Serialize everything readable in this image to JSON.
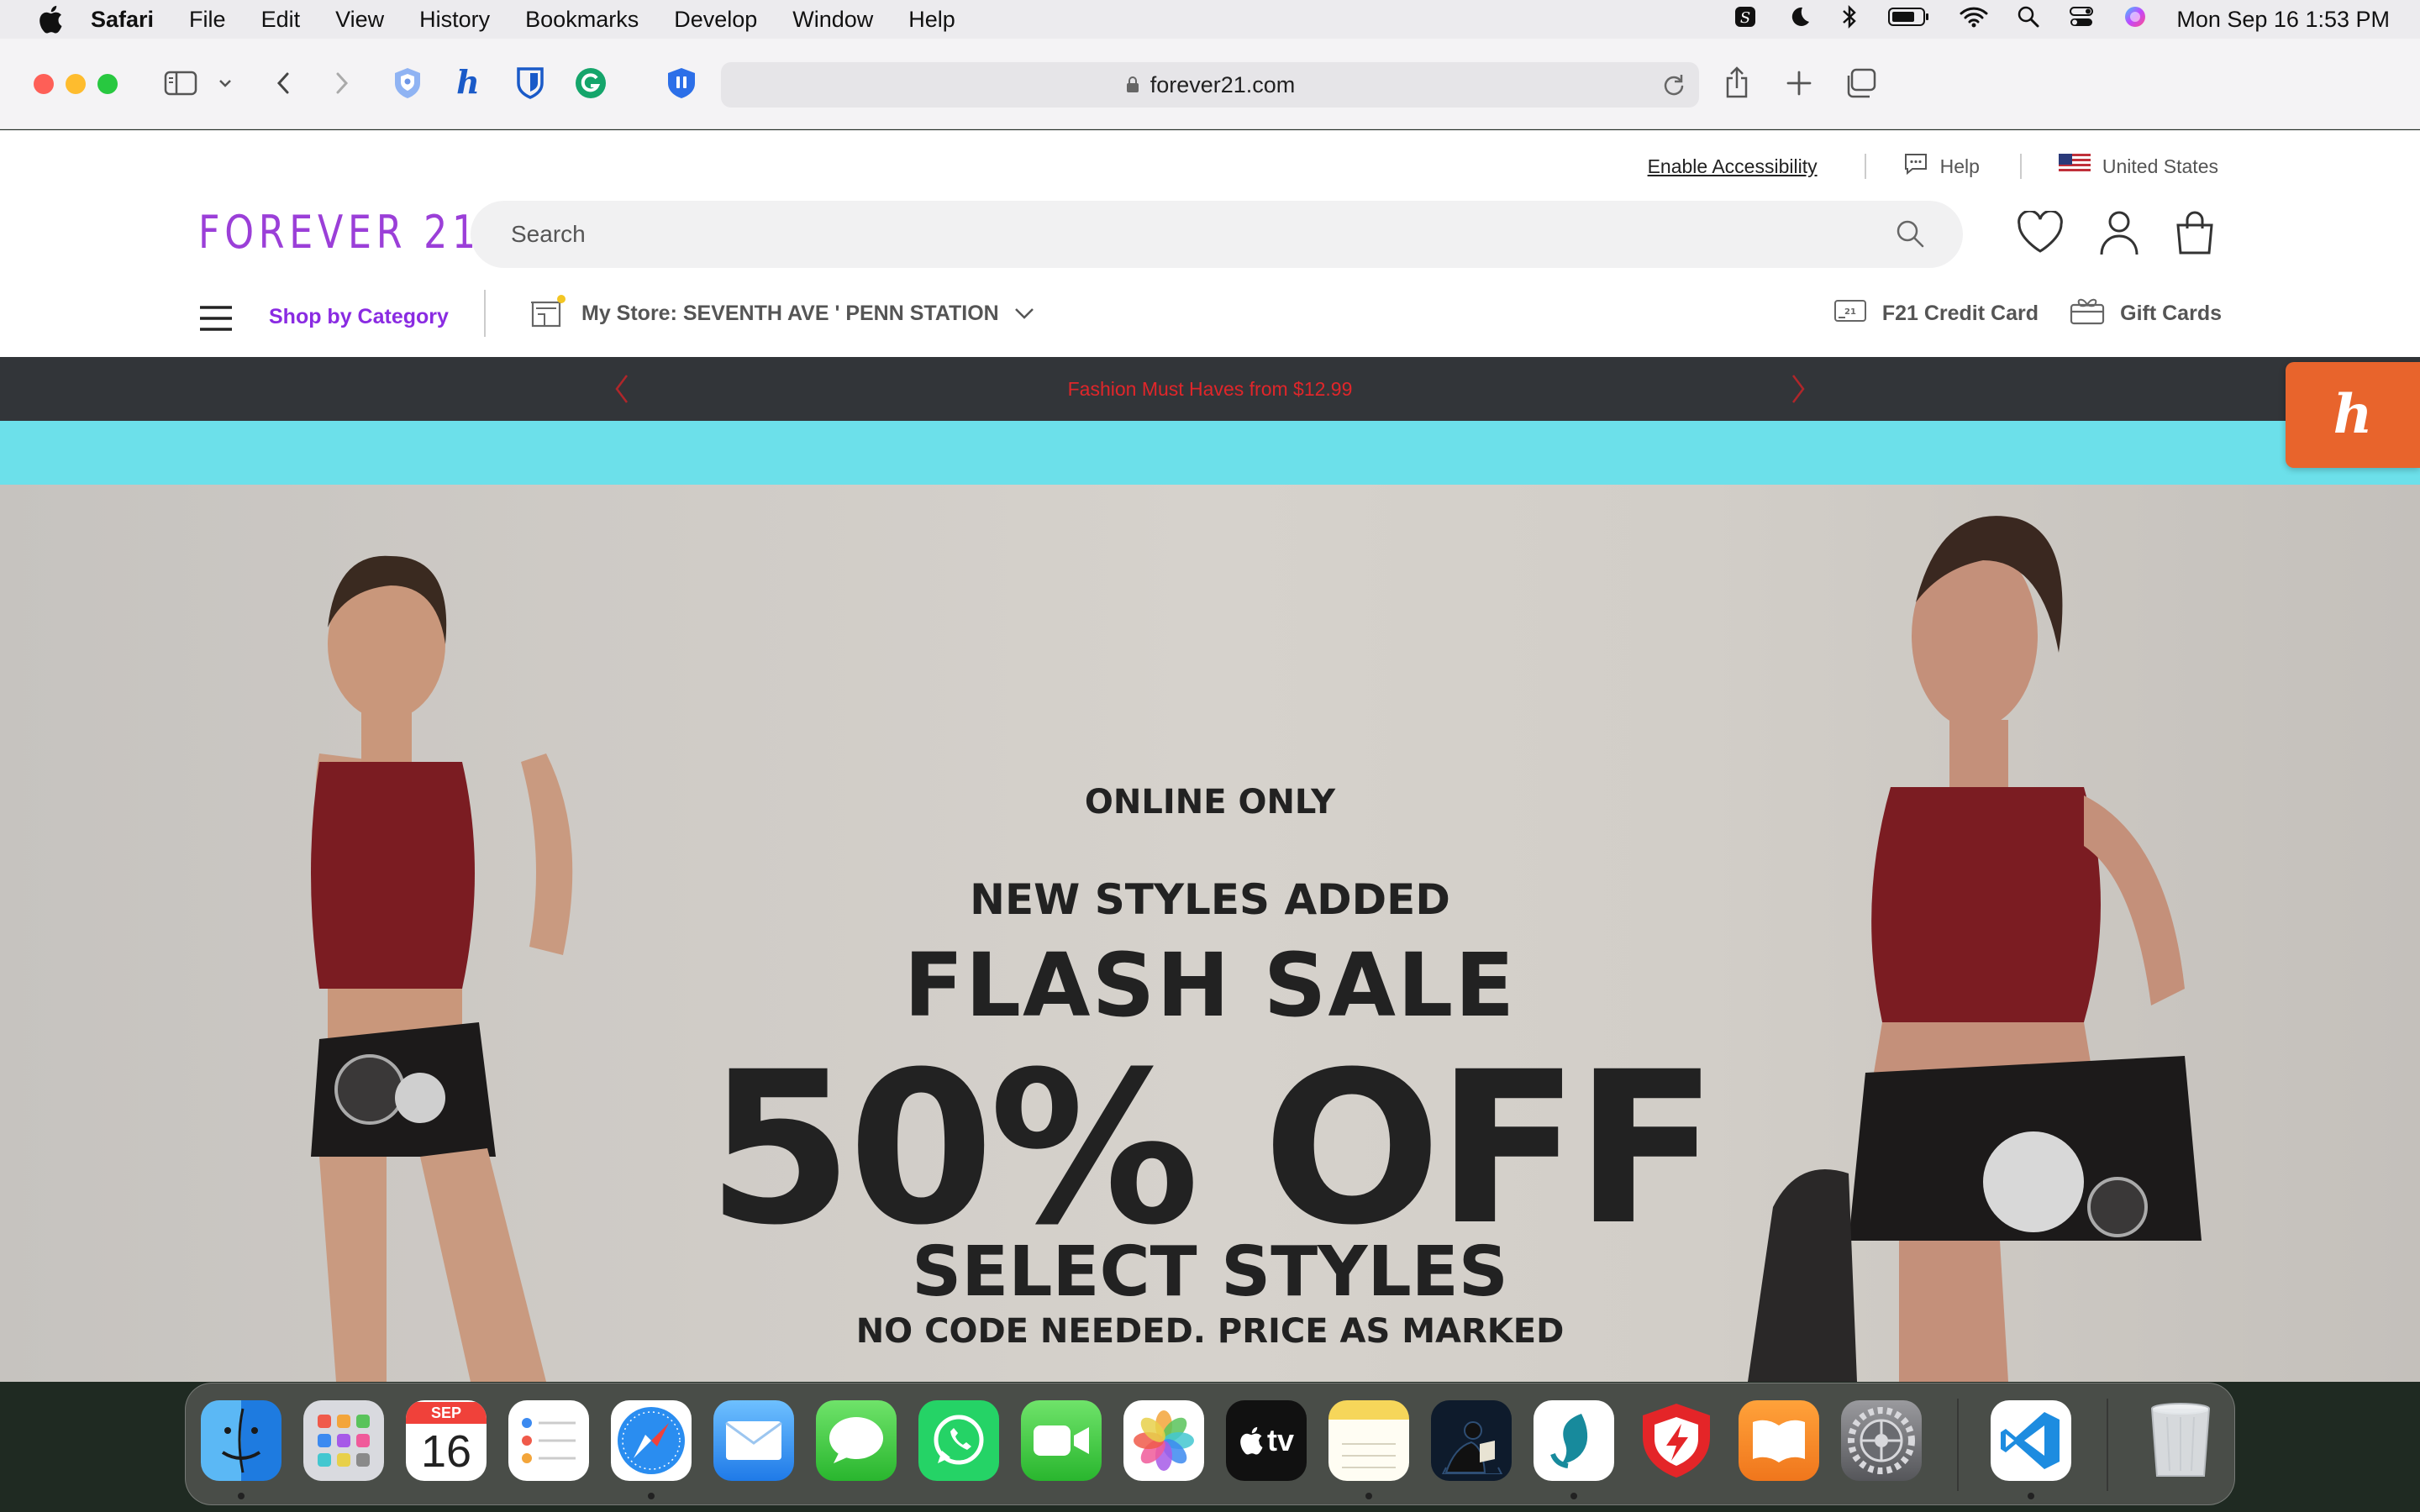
{
  "menubar": {
    "app_name": "Safari",
    "items": [
      "File",
      "Edit",
      "View",
      "History",
      "Bookmarks",
      "Develop",
      "Window",
      "Help"
    ],
    "clock": "Mon Sep 16  1:53 PM"
  },
  "browser": {
    "url": "forever21.com"
  },
  "site": {
    "utility": {
      "accessibility": "Enable Accessibility",
      "help": "Help",
      "country": "United States"
    },
    "logo": "FOREVER 21",
    "search_placeholder": "Search",
    "nav": {
      "shop_by_category": "Shop by Category",
      "my_store": "My Store: SEVENTH AVE ' PENN STATION",
      "credit_card": "F21 Credit Card",
      "gift_cards": "Gift Cards"
    },
    "promo_text": "Fashion Must Haves from $12.99",
    "hero": {
      "online_only": "ONLINE ONLY",
      "new_styles": "NEW STYLES ADDED",
      "flash_sale": "FLASH SALE",
      "discount": "50% OFF",
      "select_styles": "SELECT STYLES",
      "no_code": "NO CODE NEEDED. PRICE AS MARKED"
    }
  },
  "dock": {
    "calendar_month": "SEP",
    "calendar_day": "16",
    "tv_label": "tv"
  },
  "colors": {
    "brand_purple": "#8a2be2",
    "promo_bg": "#323539",
    "promo_text": "#e0262a",
    "teal_band": "#6ce0ea",
    "honey_orange": "#e8642c"
  }
}
